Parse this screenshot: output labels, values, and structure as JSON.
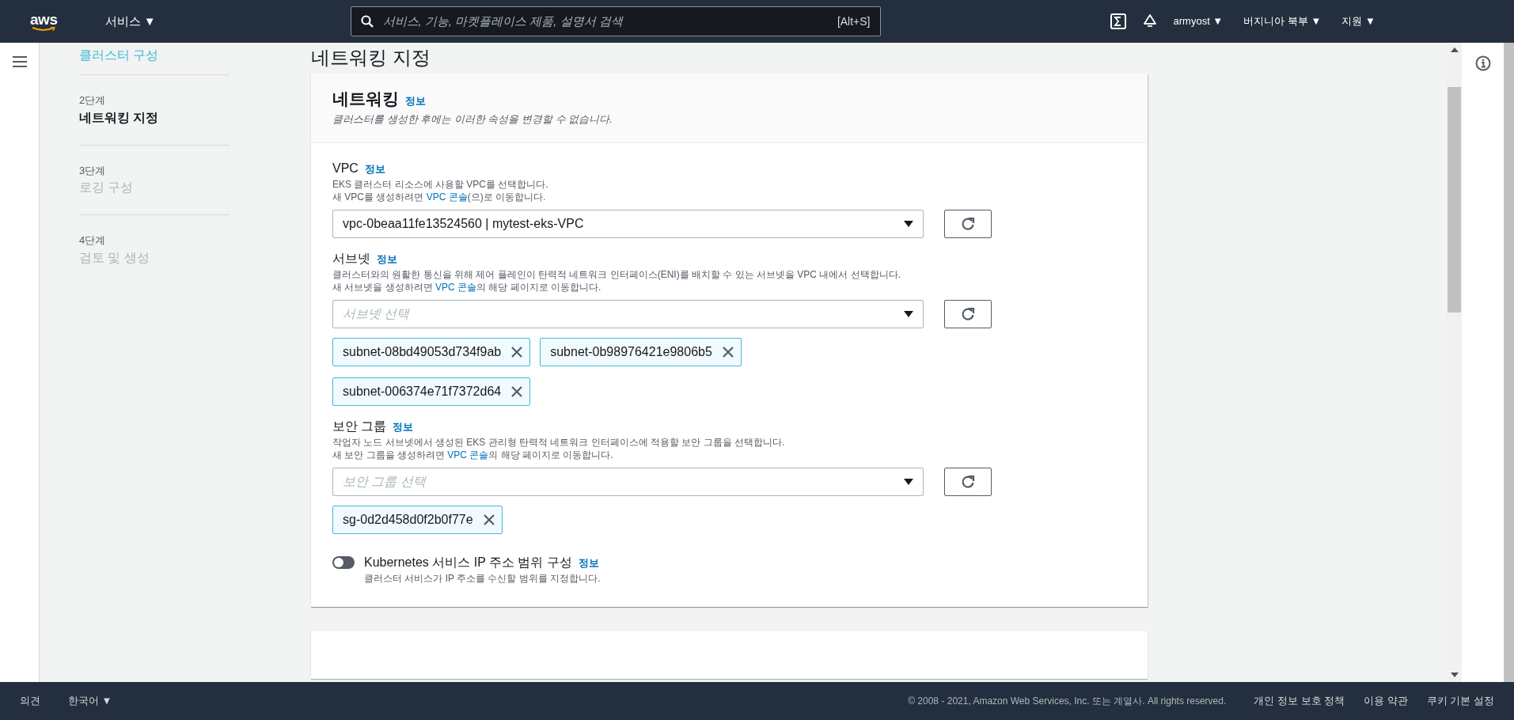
{
  "header": {
    "logo": "aws",
    "services": "서비스 ▼",
    "search": {
      "placeholder": "서비스, 기능, 마켓플레이스 제품, 설명서 검색",
      "shortcut": "[Alt+S]"
    },
    "user": "armyost ▼",
    "region": "버지니아 북부 ▼",
    "support": "지원 ▼"
  },
  "steps": [
    {
      "kind": "link",
      "title": "클러스터 구성",
      "selected": false
    },
    {
      "kind": "step",
      "step": "2단계",
      "title": "네트워킹 지정",
      "selected": true
    },
    {
      "kind": "step",
      "step": "3단계",
      "title": "로깅 구성",
      "selected": false
    },
    {
      "kind": "step",
      "step": "4단계",
      "title": "검토 및 생성",
      "selected": false
    }
  ],
  "page_title": "네트워킹 지정",
  "panel": {
    "title": "네트워킹",
    "info": "정보",
    "description": "클러스터를 생성한 후에는 이러한 속성을 변경할 수 없습니다.",
    "fields": [
      {
        "kind": "select",
        "label": "VPC",
        "info": "정보",
        "description": [
          [
            {
              "text": "EKS 클러스터 리소스에 사용할 VPC를 선택합니다."
            }
          ],
          [
            {
              "text": "새 VPC를 생성하려면 "
            },
            {
              "text": "VPC 콘솔",
              "kind": "link"
            },
            {
              "text": "(으)로 이동합니다."
            }
          ]
        ],
        "value": "vpc-0beaa11fe13524560 | mytest-eks-VPC"
      },
      {
        "kind": "select",
        "label": "서브넷",
        "info": "정보",
        "description": [
          [
            {
              "text": "클러스터와의 원활한 통신을 위해 제어 플레인이 탄력적 네트워크 인터페이스(ENI)를 배치할 수 있는 서브넷을 VPC 내에서 선택합니다."
            }
          ],
          [
            {
              "text": "새 서브넷을 생성하려면 "
            },
            {
              "text": "VPC 콘솔",
              "kind": "link"
            },
            {
              "text": "의 해당 페이지로 이동합니다."
            }
          ]
        ],
        "placeholder": "서브넷 선택",
        "tokens": [
          "subnet-08bd49053d734f9ab",
          "subnet-0b98976421e9806b5",
          "subnet-006374e71f7372d64"
        ]
      },
      {
        "kind": "select",
        "label": "보안 그룹",
        "info": "정보",
        "description": [
          [
            {
              "text": "작업자 노드 서브넷에서 생성된 EKS 관리형 탄력적 네트워크 인터페이스에 적용할 보안 그룹을 선택합니다."
            }
          ],
          [
            {
              "text": "새 보안 그룹을 생성하려면 "
            },
            {
              "text": "VPC 콘솔",
              "kind": "link"
            },
            {
              "text": "의 해당 페이지로 이동합니다."
            }
          ]
        ],
        "placeholder": "보안 그룹 선택",
        "tokens": [
          "sg-0d2d458d0f2b0f77e"
        ]
      },
      {
        "kind": "toggle",
        "label": "Kubernetes 서비스 IP 주소 범위 구성",
        "info": "정보",
        "description": [
          [
            {
              "text": "클러스터 서비스가 IP 주소를 수신할 범위를 지정합니다."
            }
          ]
        ],
        "on": false
      }
    ]
  },
  "footer": {
    "feedback": "의견",
    "language": "한국어 ▼",
    "copyright": "© 2008 - 2021, Amazon Web Services, Inc. 또는 계열사. All rights reserved.",
    "links": [
      "개인 정보 보호 정책",
      "이용 약관",
      "쿠키 기본 설정"
    ]
  }
}
